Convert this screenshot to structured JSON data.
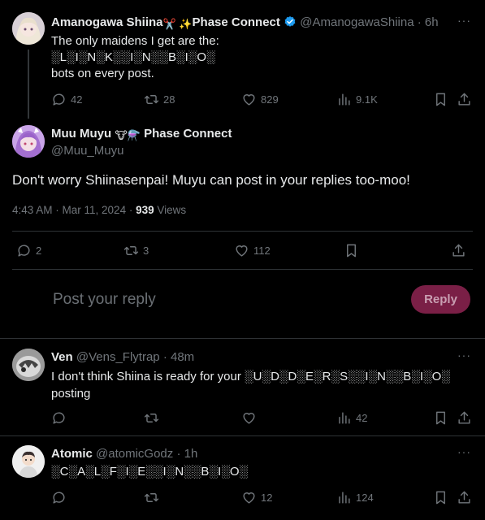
{
  "tweet1": {
    "name": "Amanogawa Shiina",
    "name_emoji": "✂️ ✨",
    "affiliation": "Phase Connect",
    "handle": "@AmanogawaShiina",
    "time": "· 6h",
    "line1": "The only maidens I get are the:",
    "line2": "░L░I░N░K░░I░N░░B░I░O░",
    "line3": "bots on every post.",
    "replies": "42",
    "retweets": "28",
    "likes": "829",
    "views": "9.1K"
  },
  "main": {
    "name": "Muu Muyu",
    "name_emoji": "🐮⚗️",
    "affiliation": "Phase Connect",
    "handle": "@Muu_Muyu",
    "text": "Don't worry Shiinasenpai! Muyu can post in your replies too-moo!",
    "time": "4:43 AM · Mar 11, 2024 ·",
    "views_count": "939",
    "views_label": "Views",
    "replies": "2",
    "retweets": "3",
    "likes": "112"
  },
  "composer": {
    "placeholder": "Post your reply",
    "button": "Reply"
  },
  "reply1": {
    "name": "Ven",
    "handle": "@Vens_Flytrap",
    "time": "· 48m",
    "text_a": "I don't think Shiina is ready for your",
    "text_noise": "░U░D░D░E░R░S░░I░N░░B░I░O░",
    "text_b": "posting",
    "views": "42"
  },
  "reply2": {
    "name": "Atomic",
    "handle": "@atomicGodz",
    "time": "· 1h",
    "text": "░C░A░L░F░I░E░░I░N░░B░I░O░",
    "likes": "12",
    "views": "124"
  },
  "more_label": "···",
  "colors": {
    "background": "#000000",
    "text": "#e7e9ea",
    "muted": "#71767b",
    "divider": "#2f3336",
    "reply_button": "#7a1f46",
    "verified": "#1d9bf0"
  }
}
